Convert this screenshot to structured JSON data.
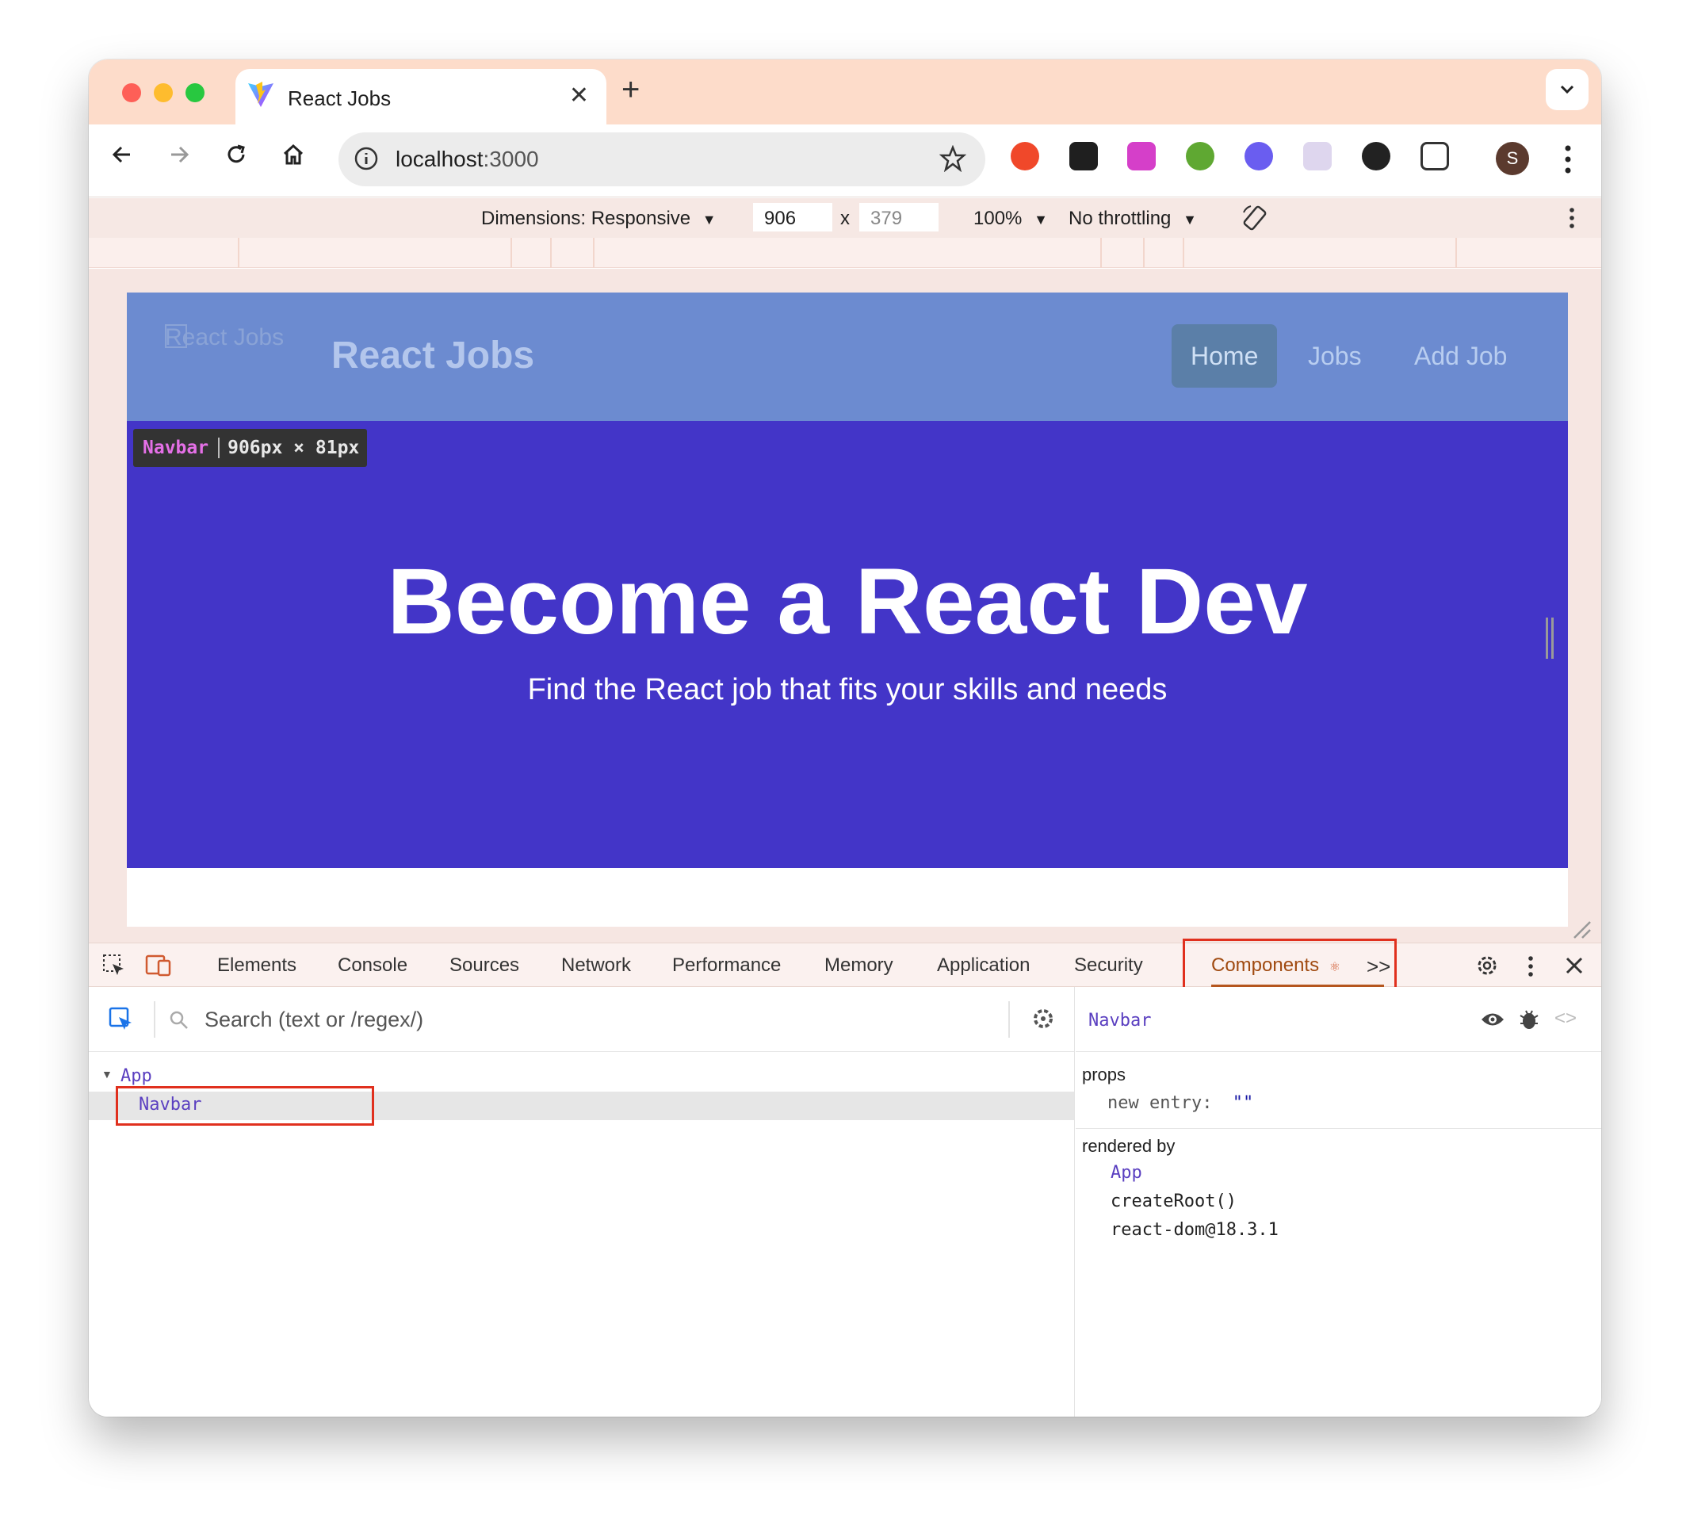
{
  "browser": {
    "tab_title": "React Jobs",
    "tab_close": "✕",
    "new_tab": "+",
    "url_host": "localhost",
    "url_port": ":3000",
    "avatar_letter": "S"
  },
  "device_toolbar": {
    "dimensions_label": "Dimensions: Responsive",
    "width": "906",
    "times": "x",
    "height": "379",
    "zoom": "100%",
    "throttling": "No throttling"
  },
  "page": {
    "logo_alt": "React Jobs",
    "brand": "React Jobs",
    "nav_links": [
      "Home",
      "Jobs",
      "Add Job"
    ],
    "hero_title": "Become a React Dev",
    "hero_subtitle": "Find the React job that fits your skills and needs",
    "inspect_tooltip": {
      "name": "Navbar",
      "size": "906px × 81px"
    }
  },
  "devtools": {
    "tabs": [
      "Elements",
      "Console",
      "Sources",
      "Network",
      "Performance",
      "Memory",
      "Application",
      "Security"
    ],
    "active_tab": "Components",
    "more_tabs": ">>",
    "search_placeholder": "Search (text or /regex/)",
    "tree": {
      "root": "App",
      "child": "Navbar"
    },
    "inspector": {
      "selected": "Navbar",
      "props_heading": "props",
      "prop_key": "new entry",
      "prop_colon": ":",
      "prop_value": "\"\"",
      "rendered_by_heading": "rendered by",
      "rendered_by": [
        "App",
        "createRoot()",
        "react-dom@18.3.1"
      ]
    }
  },
  "colors": {
    "titlebar": "#fddcca",
    "navbar": "#6c8bd0",
    "hero": "#4335c8",
    "annotation_red": "#e0301e",
    "component_purple": "#5a3fc0"
  }
}
